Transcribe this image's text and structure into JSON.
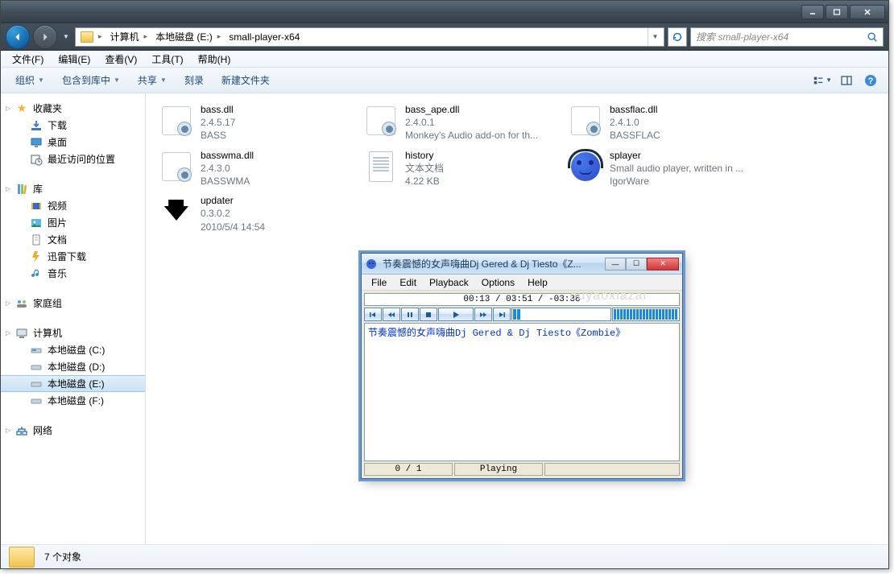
{
  "window": {
    "minimize": "_",
    "maximize": "☐",
    "close": "✕"
  },
  "breadcrumb": {
    "seg1": "计算机",
    "seg2": "本地磁盘 (E:)",
    "seg3": "small-player-x64"
  },
  "search": {
    "placeholder": "搜索 small-player-x64"
  },
  "menubar": {
    "file": "文件(F)",
    "edit": "编辑(E)",
    "view": "查看(V)",
    "tools": "工具(T)",
    "help": "帮助(H)"
  },
  "toolbar": {
    "organize": "组织",
    "include": "包含到库中",
    "share": "共享",
    "burn": "刻录",
    "newfolder": "新建文件夹"
  },
  "nav": {
    "favorites": {
      "label": "收藏夹",
      "downloads": "下载",
      "desktop": "桌面",
      "recent": "最近访问的位置"
    },
    "libraries": {
      "label": "库",
      "videos": "视频",
      "pictures": "图片",
      "documents": "文档",
      "xunlei": "迅雷下载",
      "music": "音乐"
    },
    "homegroup": {
      "label": "家庭组"
    },
    "computer": {
      "label": "计算机",
      "c": "本地磁盘 (C:)",
      "d": "本地磁盘 (D:)",
      "e": "本地磁盘 (E:)",
      "f": "本地磁盘 (F:)"
    },
    "network": {
      "label": "网络"
    }
  },
  "files": [
    {
      "name": "bass.dll",
      "line2": "2.4.5.17",
      "line3": "BASS",
      "icon": "dll"
    },
    {
      "name": "bass_ape.dll",
      "line2": "2.4.0.1",
      "line3": "Monkey's Audio add-on for th...",
      "icon": "dll"
    },
    {
      "name": "bassflac.dll",
      "line2": "2.4.1.0",
      "line3": "BASSFLAC",
      "icon": "dll"
    },
    {
      "name": "basswma.dll",
      "line2": "2.4.3.0",
      "line3": "BASSWMA",
      "icon": "dll"
    },
    {
      "name": "history",
      "line2": "文本文档",
      "line3": "4.22 KB",
      "icon": "txt"
    },
    {
      "name": "splayer",
      "line2": "Small audio player, written in ...",
      "line3": "IgorWare",
      "icon": "splayer"
    },
    {
      "name": "updater",
      "line2": "0.3.0.2",
      "line3": "2010/5/4 14:54",
      "icon": "updater"
    }
  ],
  "status": {
    "count": "7 个对象"
  },
  "player": {
    "title": "节奏震憾的女声嗨曲Dj Gered & Dj Tiesto《Z...",
    "menu": {
      "file": "File",
      "edit": "Edit",
      "playback": "Playback",
      "options": "Options",
      "help": "Help"
    },
    "time": "00:13 / 03:51 / -03:38",
    "playlist_item": "节奏震憾的女声嗨曲Dj Gered & Dj Tiesto《Zombie》",
    "status_count": "0 / 1",
    "status_state": "Playing"
  },
  "watermark": "ouyaoxiazai"
}
